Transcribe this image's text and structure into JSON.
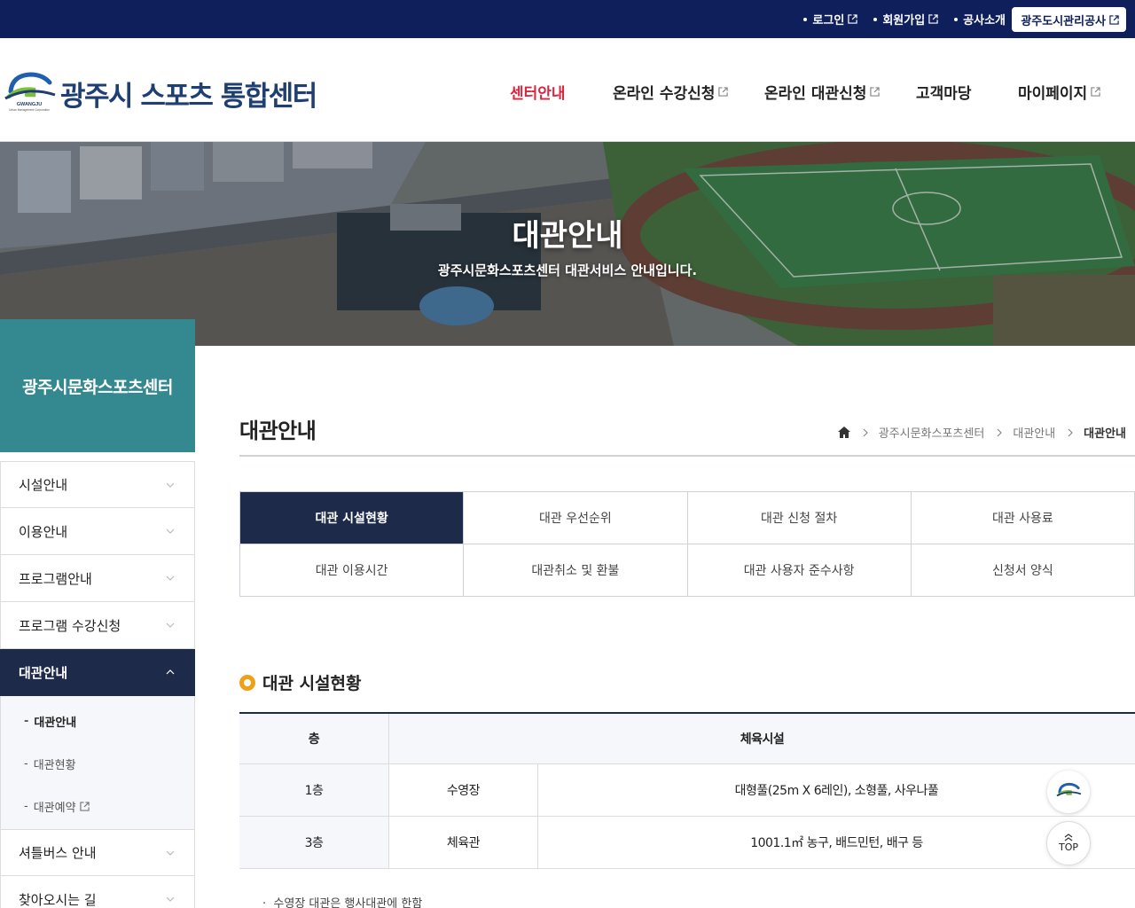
{
  "colors": {
    "top_bar": "#0f1f5c",
    "accent_active": "#d7263d",
    "sidebar_head": "#348991",
    "active_tab": "#1e2a49",
    "bullet": "#f0a016"
  },
  "topbar": {
    "login": "로그인",
    "signup": "회원가입",
    "about": "공사소개",
    "corp_link": "광주도시관리공사"
  },
  "header": {
    "logo_text": "GWANGJU",
    "logo_subtext": "Urban Management Corporation",
    "site_title": "광주시 스포츠 통합센터",
    "nav": [
      "센터안내",
      "온라인 수강신청",
      "온라인 대관신청",
      "고객마당",
      "마이페이지"
    ]
  },
  "hero": {
    "title": "대관안내",
    "subtitle": "광주시문화스포츠센터 대관서비스 안내입니다."
  },
  "sidebar": {
    "title": "광주시문화스포츠센터",
    "items": [
      "시설안내",
      "이용안내",
      "프로그램안내",
      "프로그램 수강신청",
      "대관안내",
      "셔틀버스 안내",
      "찾아오시는 길"
    ],
    "sub_items": [
      "대관안내",
      "대관현황",
      "대관예약"
    ]
  },
  "content": {
    "heading": "대관안내",
    "breadcrumb": [
      "광주시문화스포츠센터",
      "대관안내",
      "대관안내"
    ],
    "tabs": [
      "대관 시설현황",
      "대관 우선순위",
      "대관 신청 절차",
      "대관 사용료",
      "대관 이용시간",
      "대관취소 및 환불",
      "대관 사용자 준수사항",
      "신청서 양식"
    ],
    "section_title": "대관 시설현황",
    "table": {
      "headers": [
        "층",
        "체육시설"
      ],
      "rows": [
        [
          "1층",
          "수영장",
          "대형풀(25m X 6레인), 소형풀, 사우나풀"
        ],
        [
          "3층",
          "체육관",
          "1001.1㎡ 농구, 배드민턴, 배구 등"
        ]
      ]
    },
    "note": "수영장 대관은 행사대관에 한함"
  },
  "floating": {
    "top_label": "TOP"
  }
}
